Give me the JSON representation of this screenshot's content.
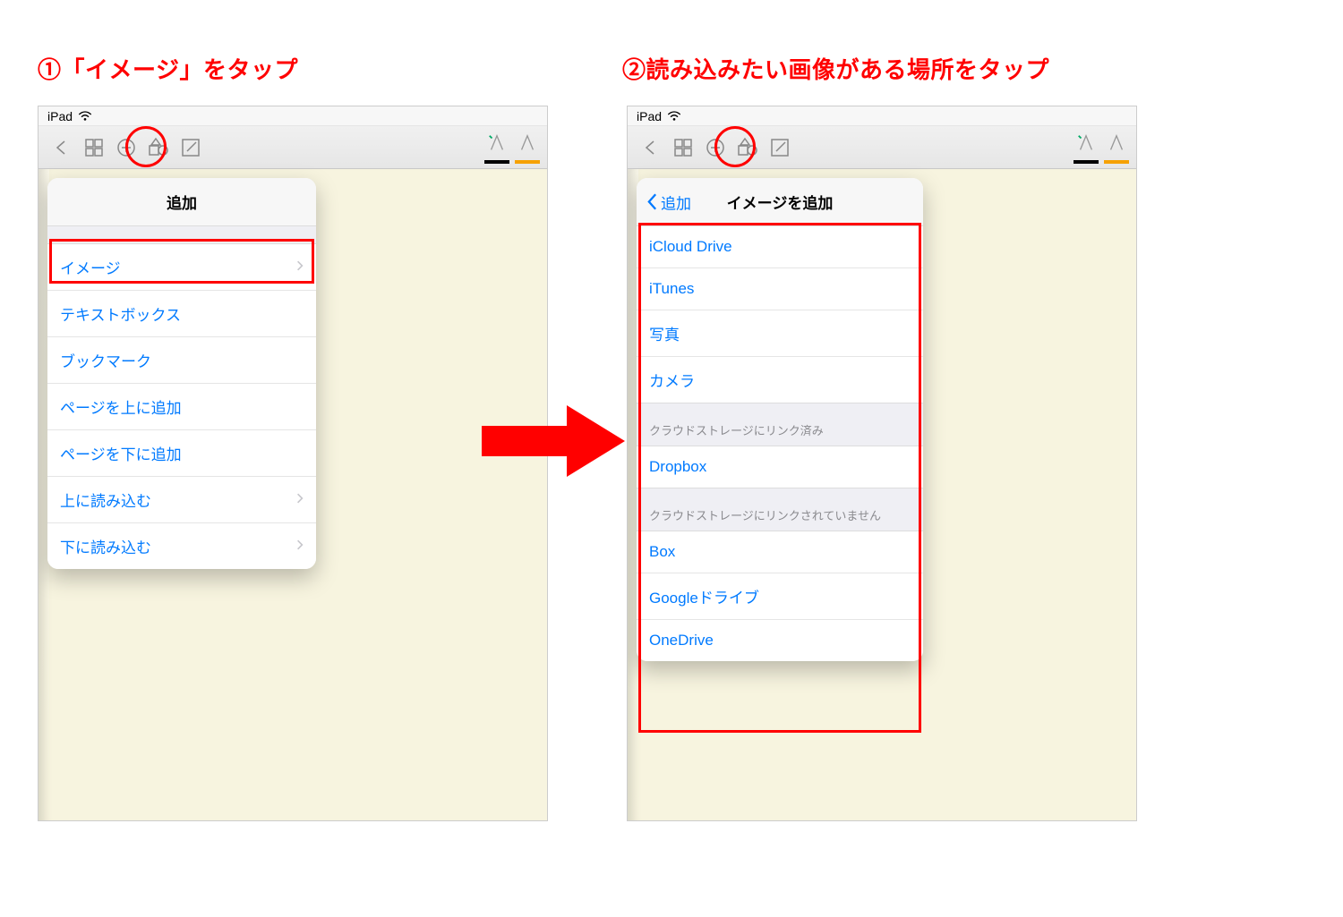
{
  "captions": {
    "left": "①「イメージ」をタップ",
    "right": "②読み込みたい画像がある場所をタップ"
  },
  "statusbar": {
    "device_label": "iPad"
  },
  "left_popup": {
    "title": "追加",
    "items": [
      {
        "label": "イメージ",
        "has_chevron": true
      },
      {
        "label": "テキストボックス",
        "has_chevron": false
      },
      {
        "label": "ブックマーク",
        "has_chevron": false
      },
      {
        "label": "ページを上に追加",
        "has_chevron": false
      },
      {
        "label": "ページを下に追加",
        "has_chevron": false
      },
      {
        "label": "上に読み込む",
        "has_chevron": true
      },
      {
        "label": "下に読み込む",
        "has_chevron": true
      }
    ]
  },
  "right_popup": {
    "back_label": "追加",
    "title": "イメージを追加",
    "section_top_items": [
      {
        "label": "iCloud Drive"
      },
      {
        "label": "iTunes"
      },
      {
        "label": "写真"
      },
      {
        "label": "カメラ"
      }
    ],
    "section_linked_label": "クラウドストレージにリンク済み",
    "section_linked_items": [
      {
        "label": "Dropbox"
      }
    ],
    "section_unlinked_label": "クラウドストレージにリンクされていません",
    "section_unlinked_items": [
      {
        "label": "Box"
      },
      {
        "label": "Googleドライブ"
      },
      {
        "label": "OneDrive"
      }
    ]
  },
  "colors": {
    "accent_red": "#ff0000",
    "ios_blue": "#007aff",
    "pen_orange": "#f6a100"
  }
}
